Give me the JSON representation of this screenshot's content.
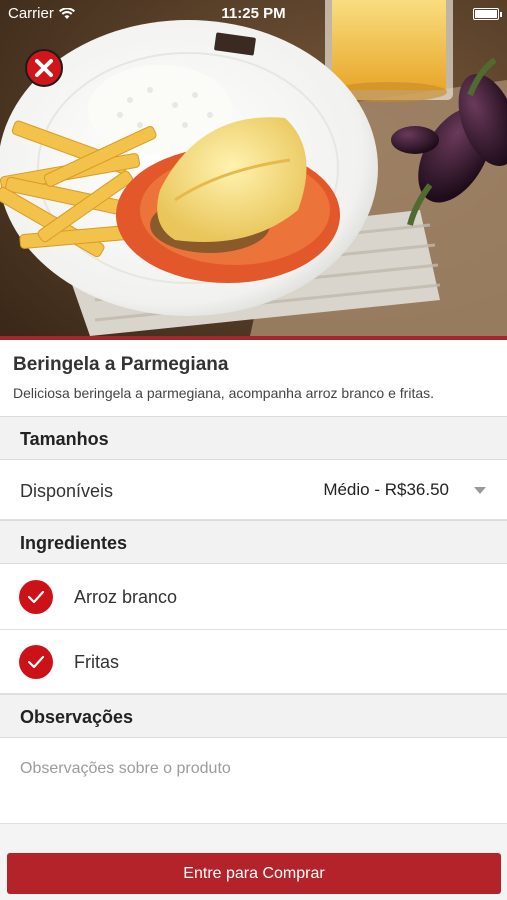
{
  "status_bar": {
    "carrier": "Carrier",
    "time": "11:25 PM"
  },
  "hero": {
    "image_description": "photo-of-eggplant-parmigiana-dish"
  },
  "product": {
    "name": "Beringela a Parmegiana",
    "description": "Deliciosa beringela a parmegiana, acompanha arroz branco e fritas."
  },
  "sizes": {
    "header": "Tamanhos",
    "row_label": "Disponíveis",
    "selected": "Médio - R$36.50"
  },
  "ingredients": {
    "header": "Ingredientes",
    "items": [
      {
        "label": "Arroz branco",
        "checked": true
      },
      {
        "label": "Fritas",
        "checked": true
      }
    ]
  },
  "observations": {
    "header": "Observações",
    "placeholder": "Observações sobre o produto"
  },
  "buy_button": {
    "label": "Entre para Comprar"
  },
  "colors": {
    "brand_red": "#b5232a",
    "check_red": "#cc1118"
  }
}
